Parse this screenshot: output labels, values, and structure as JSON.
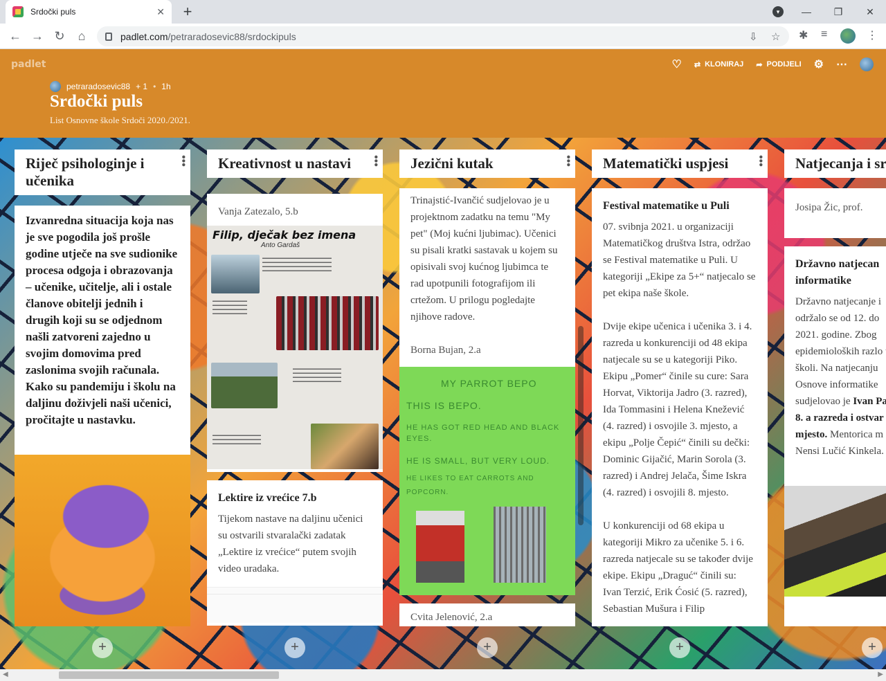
{
  "browser": {
    "tab_title": "Srdočki puls",
    "url_host": "padlet.com",
    "url_path": "/petraradosevic88/srdockipuls"
  },
  "header": {
    "brand": "padlet",
    "clone_label": "KLONIRAJ",
    "share_label": "PODIJELI",
    "author": "petraradosevic88",
    "likes": "+ 1",
    "time": "1h",
    "title": "Srdočki puls",
    "subtitle": "List Osnovne škole Srdoči 2020./2021."
  },
  "columns": [
    {
      "title": "Riječ psihologinje i učenika",
      "cards": [
        {
          "text": "Izvanredna situacija koja nas je sve pogodila još prošle godine utječe na sve sudionike procesa odgoja i obrazovanja – učenike, učitelje, ali i ostale članove obitelji jednih i drugih koji su se odjednom našli zatvoreni zajedno u svojim domovima pred zaslonima svojih računala. Kako su pandemiju i školu na daljinu doživjeli naši učenici, pročitajte u nastavku."
        }
      ]
    },
    {
      "title": "Kreativnost u nastavi",
      "cards": [
        {
          "author": "Vanja Zatezalo, 5.b",
          "doc_title": "Filip, dječak bez imena",
          "doc_author": "Anto Gardaš"
        },
        {
          "title": "Lektire iz vrećice 7.b",
          "text": "Tijekom nastave na daljinu učenici su ostvarili stvaralački zadatak „Lektire iz vrećice“ putem svojih video uradaka."
        }
      ]
    },
    {
      "title": "Jezični kutak",
      "cards": [
        {
          "text": "Trinajstić-Ivančić sudjelovao je u projektnom zadatku na temu \"My pet\" (Moj kućni ljubimac). Učenici su pisali kratki sastavak u kojem su opisivali svoj kućnog ljubimca te rad upotpunili fotografijom ili crtežom. U prilogu pogledajte njihove radove.",
          "author": "Borna Bujan, 2.a"
        },
        {
          "parrot_lines": [
            "MY PARROT BEPO",
            "THIS IS BEPO.",
            "HE HAS GOT RED HEAD AND BLACK EYES.",
            "HE IS SMALL, BUT VERY LOUD.",
            "HE LIKES TO EAT CARROTS AND POPCORN."
          ]
        },
        {
          "author": "Cvita Jelenović, 2.a"
        }
      ]
    },
    {
      "title": "Matematički uspjesi",
      "cards": [
        {
          "title": "Festival matematike u Puli",
          "paragraphs": [
            "07. svibnja 2021. u organizaciji Matematičkog društva Istra, održao se Festival matematike u Puli. U kategoriji „Ekipe za 5+“ natjecalo se pet ekipa naše škole.",
            "Dvije ekipe učenica i učenika 3. i 4. razreda u konkurenciji od 48 ekipa natjecale su se u kategoriji Piko. Ekipu „Pomer“ činile su cure: Sara Horvat, Viktorija Jadro (3. razred), Ida Tommasini i Helena Knežević (4. razred) i osvojile 3. mjesto, a ekipu „Polje Čepić“ činili su dečki: Dominic Gijačić, Marin Sorola (3. razred) i Andrej Jelača, Šime Iskra (4. razred) i osvojili 8. mjesto.",
            "U konkurenciji od 68 ekipa u kategoriji Mikro za učenike 5. i 6. razreda natjecale su se također dvije ekipe. Ekipu „Draguć“ činili su: Ivan Terzić, Erik Ćosić (5. razred), Sebastian Mušura i Filip"
          ]
        }
      ]
    },
    {
      "title": "Natjecanja i sr",
      "cards": [
        {
          "author": "Josipa Žic, prof."
        },
        {
          "title": "Državno natjecan informatike",
          "text_a": "Državno natjecanje i održalo se od 12. do 2021. godine. Zbog epidemioloških razlo u školi. Na natjecanju Osnove informatike sudjelovao je ",
          "bold": "Ivan Pa 8. a razreda i ostvar mjesto.",
          "text_b": " Mentorica m Nensi Lučić Kinkela."
        }
      ]
    }
  ],
  "colors": {
    "header": "#d7892a",
    "card": "#ffffff"
  }
}
